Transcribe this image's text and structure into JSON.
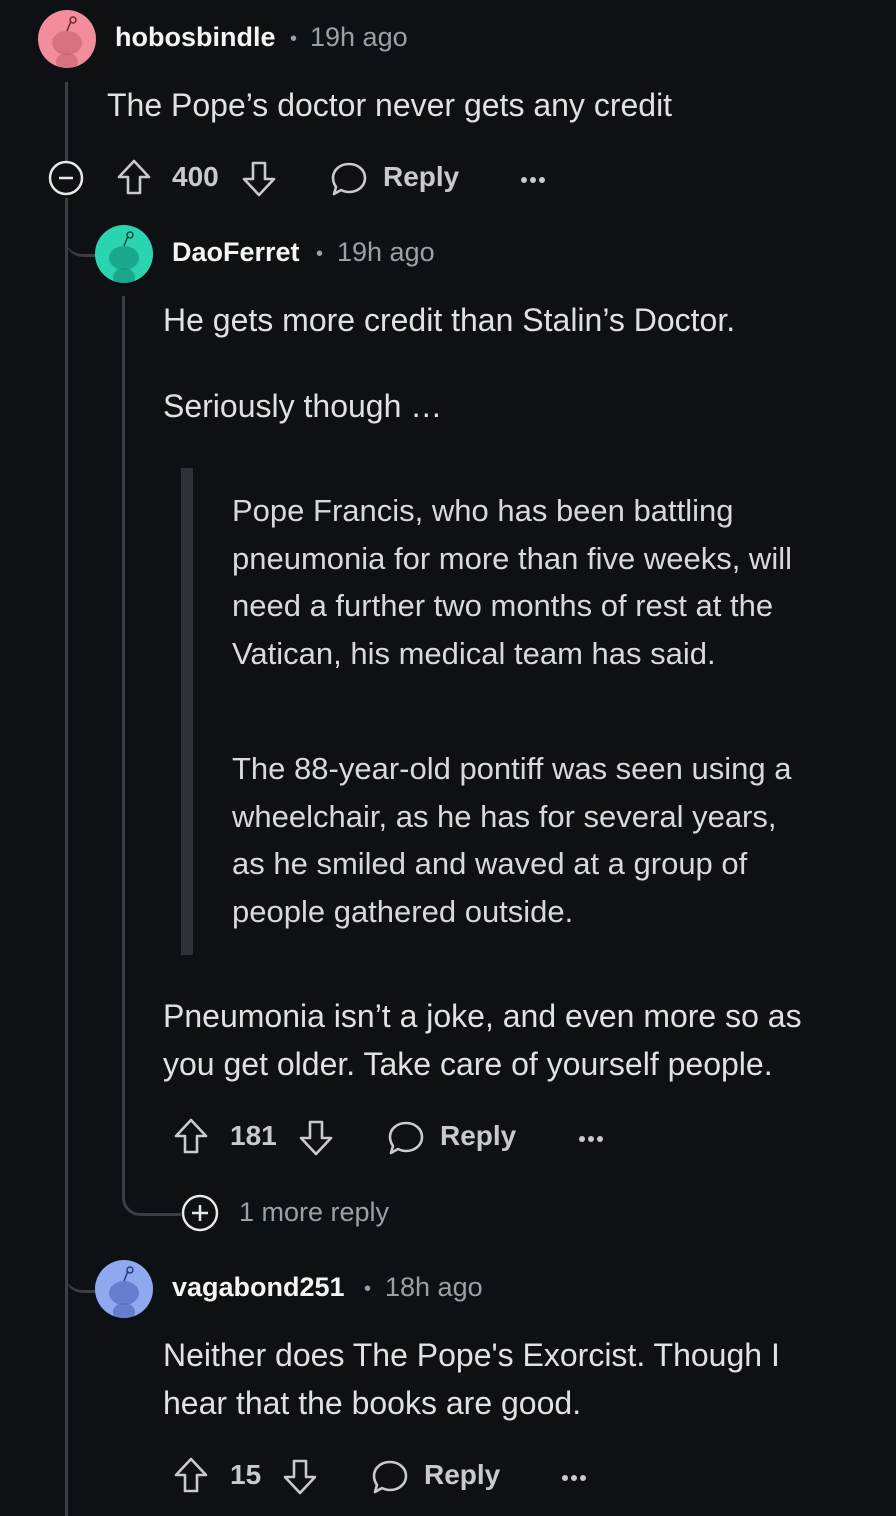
{
  "comments": [
    {
      "username": "hobosbindle",
      "time": "19h ago",
      "separator": "•",
      "body": "The Pope’s doctor never gets any credit",
      "votes": "400",
      "reply_label": "Reply",
      "avatar_color": "#f28e9b"
    },
    {
      "username": "DaoFerret",
      "time": "19h ago",
      "separator": "•",
      "body_line1": "He gets more credit than Stalin’s Doctor.",
      "body_line2": "Seriously though …",
      "quote_para1": "Pope Francis, who has been battling pneumonia for more than five weeks, will need a further two months of rest at the Vatican, his medical team has said.",
      "quote_para2": "The 88-year-old pontiff was seen using a wheelchair, as he has for several years, as he smiled and waved at a group of people gathered outside.",
      "body_line3": "Pneumonia isn’t a joke, and even more so as you get older. Take care of yourself people.",
      "votes": "181",
      "reply_label": "Reply",
      "more_replies": "1 more reply",
      "avatar_color": "#2ad4b0"
    },
    {
      "username": "vagabond251",
      "time": "18h ago",
      "separator": "•",
      "body": "Neither does The Pope's Exorcist. Though I hear that the books are good.",
      "votes": "15",
      "reply_label": "Reply",
      "avatar_color": "#8fa8f0"
    }
  ],
  "colors": {
    "background": "#0e1113",
    "thread_line": "#3a3f43",
    "quote_bar": "#2e3236"
  }
}
